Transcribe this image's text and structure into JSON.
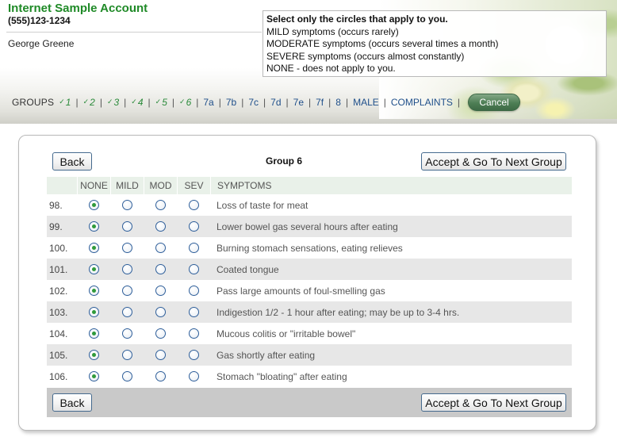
{
  "header": {
    "account_name": "Internet Sample Account",
    "phone": "(555)123-1234",
    "user_name": "George Greene"
  },
  "legend": {
    "title": "Select only the circles that apply to you.",
    "lines": [
      "MILD symptoms (occurs rarely)",
      "MODERATE symptoms (occurs several times a month)",
      "SEVERE symptoms (occurs almost constantly)",
      "NONE - does not apply to you."
    ]
  },
  "nav": {
    "label": "GROUPS",
    "groups": [
      {
        "label": "1",
        "done": true
      },
      {
        "label": "2",
        "done": true
      },
      {
        "label": "3",
        "done": true
      },
      {
        "label": "4",
        "done": true
      },
      {
        "label": "5",
        "done": true
      },
      {
        "label": "6",
        "done": true
      },
      {
        "label": "7a",
        "done": false
      },
      {
        "label": "7b",
        "done": false
      },
      {
        "label": "7c",
        "done": false
      },
      {
        "label": "7d",
        "done": false
      },
      {
        "label": "7e",
        "done": false
      },
      {
        "label": "7f",
        "done": false
      },
      {
        "label": "8",
        "done": false
      },
      {
        "label": "MALE",
        "done": false
      },
      {
        "label": "COMPLAINTS",
        "done": false
      }
    ],
    "cancel_label": "Cancel"
  },
  "panel": {
    "back_label": "Back",
    "accept_label": "Accept & Go To Next Group",
    "title": "Group 6",
    "columns": [
      "NONE",
      "MILD",
      "MOD",
      "SEV",
      "SYMPTOMS"
    ],
    "rows": [
      {
        "num": "98.",
        "symptom": "Loss of taste for meat",
        "selected": "NONE"
      },
      {
        "num": "99.",
        "symptom": "Lower bowel gas several hours after eating",
        "selected": "NONE"
      },
      {
        "num": "100.",
        "symptom": "Burning stomach sensations, eating relieves",
        "selected": "NONE"
      },
      {
        "num": "101.",
        "symptom": "Coated tongue",
        "selected": "NONE"
      },
      {
        "num": "102.",
        "symptom": "Pass large amounts of foul-smelling gas",
        "selected": "NONE"
      },
      {
        "num": "103.",
        "symptom": "Indigestion 1/2 - 1 hour after eating; may be up to 3-4 hrs.",
        "selected": "NONE"
      },
      {
        "num": "104.",
        "symptom": "Mucous colitis or \"irritable bowel\"",
        "selected": "NONE"
      },
      {
        "num": "105.",
        "symptom": "Gas shortly after eating",
        "selected": "NONE"
      },
      {
        "num": "106.",
        "symptom": "Stomach \"bloating\" after eating",
        "selected": "NONE"
      }
    ]
  },
  "colors": {
    "brand_green": "#1f8a27",
    "link_blue": "#1f4f8a",
    "radio_selected": "#2f9a3a",
    "header_row_bg": "#e9f1e9",
    "shaded_row_bg": "#e7e7e7"
  }
}
